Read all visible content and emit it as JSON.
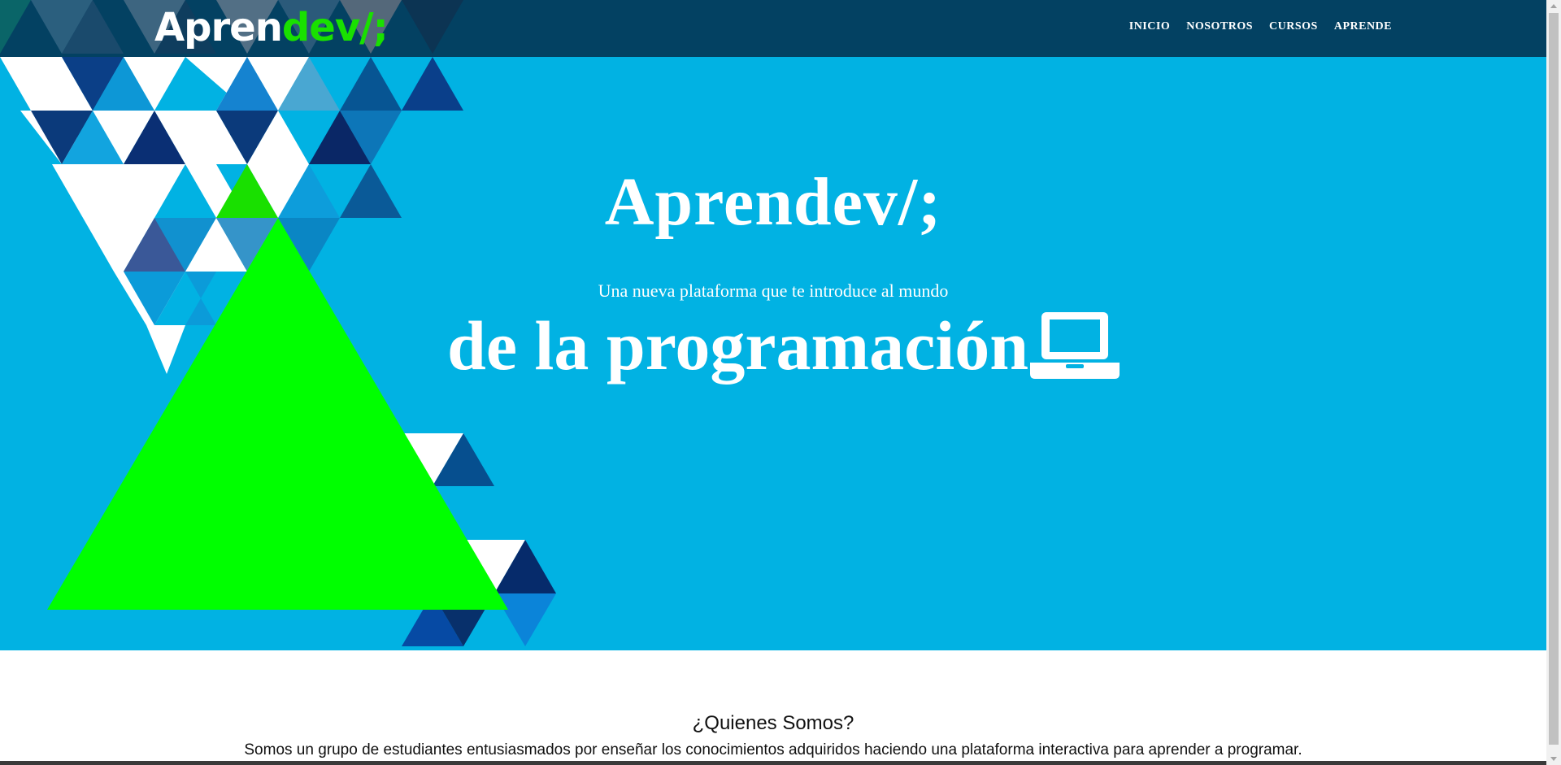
{
  "navbar": {
    "logo_part1": "Apren",
    "logo_part2": "dev",
    "logo_part3": "/;",
    "links": [
      "INICIO",
      "NOSOTROS",
      "CURSOS",
      "APRENDE"
    ]
  },
  "hero": {
    "title": "Aprendev/;",
    "subtitle": "Una nueva plataforma que te introduce al mundo",
    "tagline": "de la programación",
    "icon": "laptop-icon"
  },
  "about": {
    "heading": "¿Quienes Somos?",
    "text": "Somos un grupo de estudiantes entusiasmados por enseñar los conocimientos adquiridos haciendo una plataforma interactiva para aprender a programar."
  },
  "colors": {
    "hero_bg": "#01b2e3",
    "navbar_bg": "#033c5d",
    "accent_green": "#19e000",
    "triangle_green": "#00ff00"
  }
}
